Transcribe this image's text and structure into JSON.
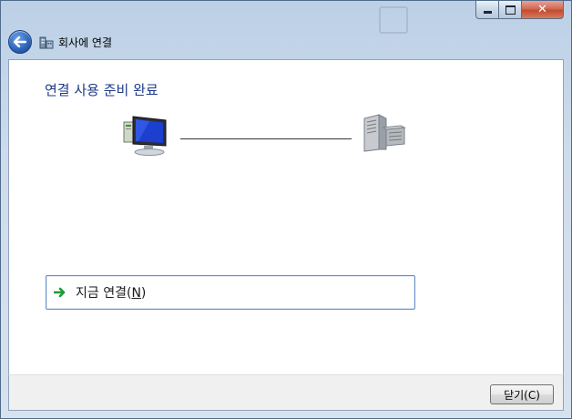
{
  "window": {
    "title": "회사에 연결",
    "close_glyph": "✕"
  },
  "content": {
    "heading": "연결 사용 준비 완료",
    "connect_option": {
      "label_main": "지금 연결(",
      "label_mnemonic": "N",
      "label_end": ")"
    }
  },
  "footer": {
    "close_button_label": "닫기(C)"
  },
  "colors": {
    "heading": "#1e3a8a",
    "accent": "#2a62b8",
    "arrow": "#1f9a3a"
  }
}
